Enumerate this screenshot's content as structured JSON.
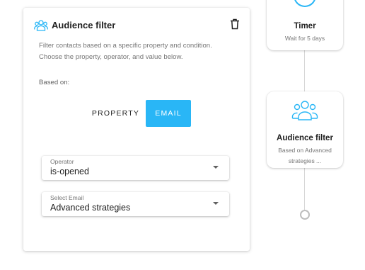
{
  "panel": {
    "title": "Audience filter",
    "description": "Filter contacts based on a specific property and condition. Choose the property, operator, and value below.",
    "based_on_label": "Based on:",
    "toggle": {
      "property_label": "PROPERTY",
      "email_label": "EMAIL",
      "selected": "EMAIL"
    },
    "operator": {
      "label": "Operator",
      "value": "is-opened"
    },
    "select_email": {
      "label": "Select Email",
      "value": "Advanced strategies"
    }
  },
  "flow": {
    "timer_node": {
      "title": "Timer",
      "subtitle": "Wait for 5 days"
    },
    "audience_node": {
      "title": "Audience filter",
      "subtitle": "Based on Advanced strategies ..."
    }
  },
  "colors": {
    "accent": "#29b6f6",
    "connector": "#d6d6d6"
  },
  "icons": [
    "people-group-icon",
    "trash-icon",
    "chevron-down-icon",
    "timer-icon",
    "people-group-icon"
  ]
}
